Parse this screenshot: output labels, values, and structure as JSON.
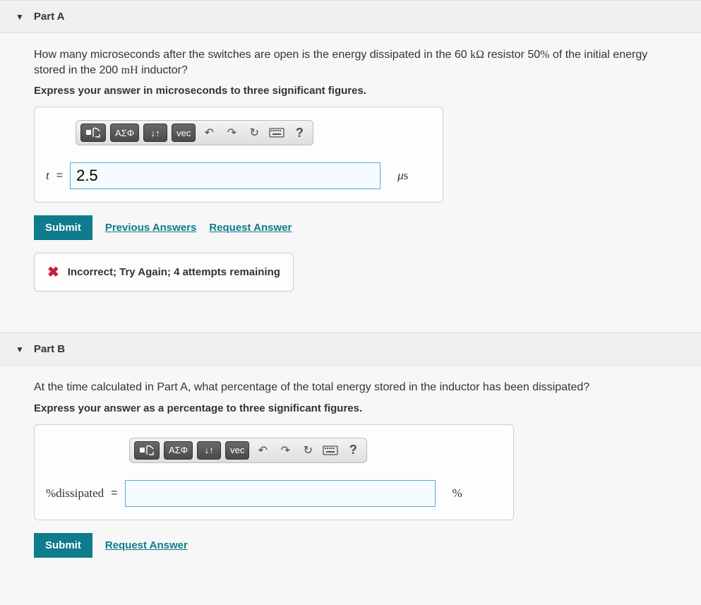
{
  "partA": {
    "title": "Part A",
    "question_html": "How many microseconds after the switches are open is the energy dissipated in the 60 kΩ resistor 50% of the initial energy stored in the 200 mH inductor?",
    "instruction": "Express your answer in microseconds to three significant figures.",
    "toolbar": {
      "templates": "■√□",
      "greek": "ΑΣΦ",
      "subsup": "↓↑",
      "vec": "vec",
      "undo": "↶",
      "redo": "↷",
      "reset": "↻",
      "keyboard": "⌨",
      "help": "?"
    },
    "var_label": "t",
    "input_value": "2.5",
    "unit": "μs",
    "submit": "Submit",
    "prev_answers": "Previous Answers",
    "request_answer": "Request Answer",
    "feedback": "Incorrect; Try Again; 4 attempts remaining"
  },
  "partB": {
    "title": "Part B",
    "question_html": "At the time calculated in Part A, what percentage of the total energy stored in the inductor has been dissipated?",
    "instruction": "Express your answer as a percentage to three significant figures.",
    "toolbar": {
      "templates": "■√□",
      "greek": "ΑΣΦ",
      "subsup": "↓↑",
      "vec": "vec",
      "undo": "↶",
      "redo": "↷",
      "reset": "↻",
      "keyboard": "⌨",
      "help": "?"
    },
    "var_label": "%dissipated",
    "input_value": "",
    "unit": "%",
    "submit": "Submit",
    "request_answer": "Request Answer"
  }
}
